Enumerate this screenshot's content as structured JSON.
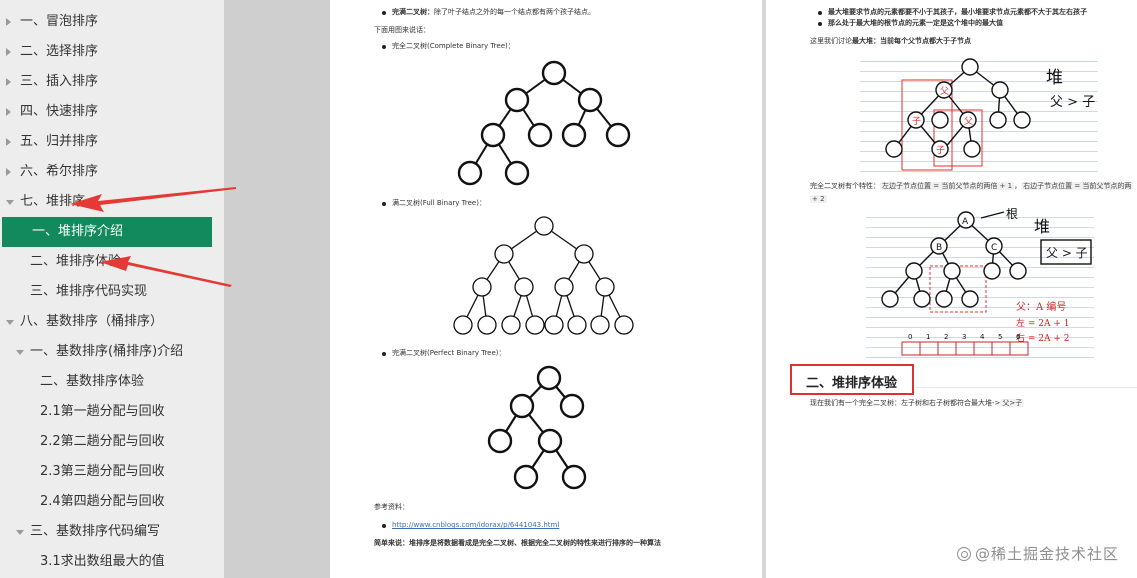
{
  "sidebar": {
    "items": [
      {
        "label": "一、冒泡排序",
        "expand": "right"
      },
      {
        "label": "二、选择排序",
        "expand": "right"
      },
      {
        "label": "三、插入排序",
        "expand": "right"
      },
      {
        "label": "四、快速排序",
        "expand": "right"
      },
      {
        "label": "五、归并排序",
        "expand": "right"
      },
      {
        "label": "六、希尔排序",
        "expand": "right"
      },
      {
        "label": "七、堆排序",
        "expand": "down"
      },
      {
        "label": "一、堆排序介绍",
        "expand": "none",
        "active": true
      },
      {
        "label": "二、堆排序体验",
        "expand": "none"
      },
      {
        "label": "三、堆排序代码实现",
        "expand": "none"
      },
      {
        "label": "八、基数排序（桶排序）",
        "expand": "down"
      },
      {
        "label": "一、基数排序(桶排序)介绍",
        "expand": "down"
      },
      {
        "label": "二、基数排序体验",
        "expand": "none"
      },
      {
        "label": "2.1第一趟分配与回收",
        "expand": "none"
      },
      {
        "label": "2.2第二趟分配与回收",
        "expand": "none"
      },
      {
        "label": "2.3第三趟分配与回收",
        "expand": "none"
      },
      {
        "label": "2.4第四趟分配与回收",
        "expand": "none"
      },
      {
        "label": "三、基数排序代码编写",
        "expand": "down"
      },
      {
        "label": "3.1求出数组最大的值",
        "expand": "none"
      }
    ]
  },
  "page1": {
    "full_tree_def_label": "完满二叉树：",
    "full_tree_def_text": "除了叶子结点之外的每一个结点都有两个孩子结点。",
    "intro": "下面用图来说话：",
    "complete_tree_caption": "完全二叉树(Complete Binary Tree)：",
    "full_tree_caption": "满二叉树(Full Binary Tree)：",
    "perfect_tree_caption": "完满二叉树(Perfect Binary Tree)：",
    "refs_label": "参考资料：",
    "ref_link": "http://www.cnblogs.com/idorax/p/6441043.html",
    "summary_label": "简单来说：",
    "summary_text": "堆排序是将数据看成是完全二叉树、根据完全二叉树的特性来进行排序的一种算法"
  },
  "page2": {
    "bullet1": "最大堆要求节点的元素都要不小于其孩子，最小堆要求节点元素都不大于其左右孩子",
    "bullet2": "那么处于最大堆的根节点的元素一定是这个堆中的最大值",
    "discuss_prefix": "这里我们讨论",
    "discuss_bold": "最大堆：当前每个父节点都大于子节点",
    "property_prefix": "完全二叉树有个特性：",
    "property_code1": "左边子节点位置 = 当前父节点的两倍 + 1",
    "property_mid": "，",
    "property_code2": "右边子节点位置 = 当前父节点的两",
    "property_code2_cont": "+ 2",
    "heading": "二、堆排序体验",
    "experience_text": "现在我们有一个完全二叉树：左子树和右子树都符合最大堆->",
    "experience_code": "父>子",
    "hw1_title": "堆",
    "hw1_rule": "父 > 子",
    "hw1_node_parent": "父",
    "hw1_node_child": "子",
    "hw2_label_arrow": "根",
    "hw2_title": "堆",
    "hw2_rule": "父 > 子",
    "hw2_note_label": "父：A 编号",
    "hw2_left": "左 = 2A + 1",
    "hw2_right": "右 = 2A + 2",
    "hw2_root": "A",
    "hw2_b": "B",
    "hw2_c": "C",
    "hw2_array_indices": [
      "0",
      "1",
      "2",
      "3",
      "4",
      "5",
      "6"
    ]
  },
  "watermark": "@稀土掘金技术社区",
  "colors": {
    "active": "#138a5e",
    "arrow": "#e53935",
    "heading_border": "#e03131"
  }
}
